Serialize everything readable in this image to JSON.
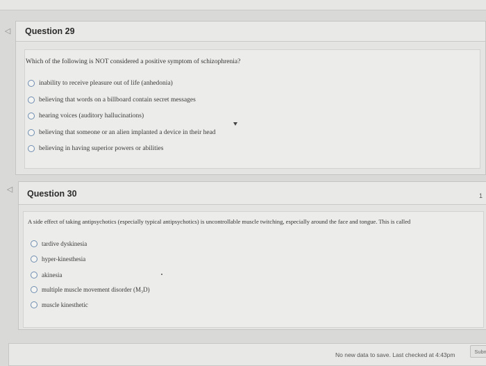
{
  "questions": [
    {
      "title": "Question 29",
      "text": "Which of the following is NOT considered a positive symptom of schizophrenia?",
      "options": [
        "inability to receive pleasure out of life (anhedonia)",
        "believing that words on a billboard contain secret messages",
        "hearing voices (auditory hallucinations)",
        "believing that someone or an alien implanted a device in their head",
        "believing in having superior powers or abilities"
      ]
    },
    {
      "title": "Question 30",
      "text": "A side effect of taking antipsychotics (especially typical antipsychotics) is uncontrollable muscle twitching, especially around the face and tongue. This is called",
      "options": [
        "tardive dyskinesia",
        "hyper-kinesthesia",
        "akinesia",
        "multiple muscle movement disorder (M₃D)",
        "muscle kinesthetic"
      ]
    }
  ],
  "footer": {
    "status": "No new data to save. Last checked at 4:43pm",
    "submit_label": "Submit"
  },
  "pager_fragment": "1",
  "icons": {
    "question_flag": "flag-icon",
    "radio": "radio-icon"
  }
}
